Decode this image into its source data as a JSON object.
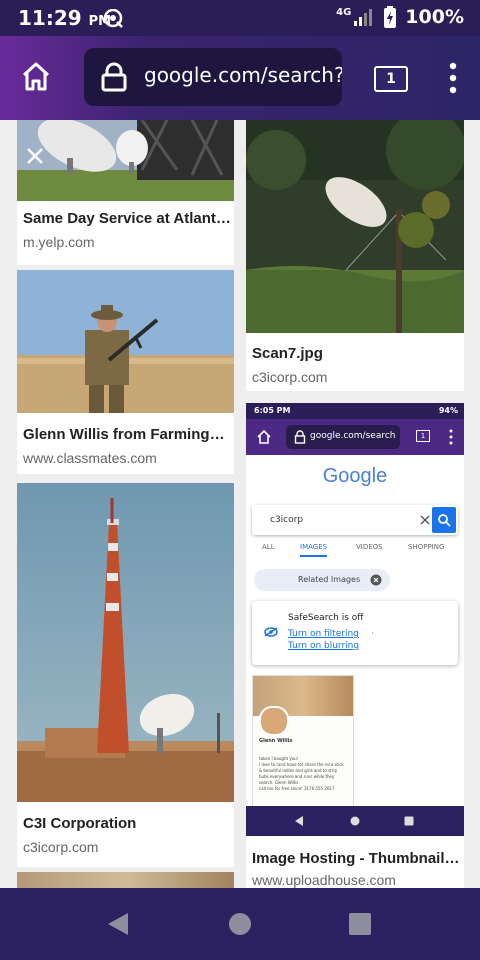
{
  "status": {
    "time": "11:29",
    "ampm": "PM",
    "network": "4G",
    "battery": "100%"
  },
  "browser": {
    "url": "google.com/search?",
    "tab_count": "1"
  },
  "results": [
    {
      "title": "Same Day Service at Atlanta...",
      "source": "m.yelp.com"
    },
    {
      "title": "Scan7.jpg",
      "source": "c3icorp.com"
    },
    {
      "title": "Glenn Willis from Farmingdale...",
      "source": "www.classmates.com"
    },
    {
      "title": "C3I Corporation",
      "source": "c3icorp.com"
    },
    {
      "title": "Image Hosting - Thumbnail ...",
      "source": "www.uploadhouse.com"
    }
  ],
  "mini": {
    "time": "6:05 PM",
    "battery": "94%",
    "url": "google.com/search",
    "tab_count": "1",
    "logo": "Google",
    "query": "c3icorp",
    "tabs": [
      "ALL",
      "IMAGES",
      "VIDEOS",
      "SHOPPING"
    ],
    "related": "Related Images",
    "safesearch_title": "SafeSearch is off",
    "turn_on_filtering": "Turn on filtering",
    "separator": "·",
    "turn_on_blurring": "Turn on blurring",
    "profile_name": "Glenn Willis",
    "profile_lines": [
      "taken I bought you!",
      "I love to (and have to) share the nice stick",
      "& beautiful ladies and girls and to strip",
      "hubs everywhere and runs while they",
      "search. Glenn Willis",
      "call me for free since! 3176 555 2017"
    ]
  },
  "colors": {
    "accent": "#1a73e8",
    "status_bar": "#2b1d57",
    "nav_bar": "#2b2060"
  }
}
